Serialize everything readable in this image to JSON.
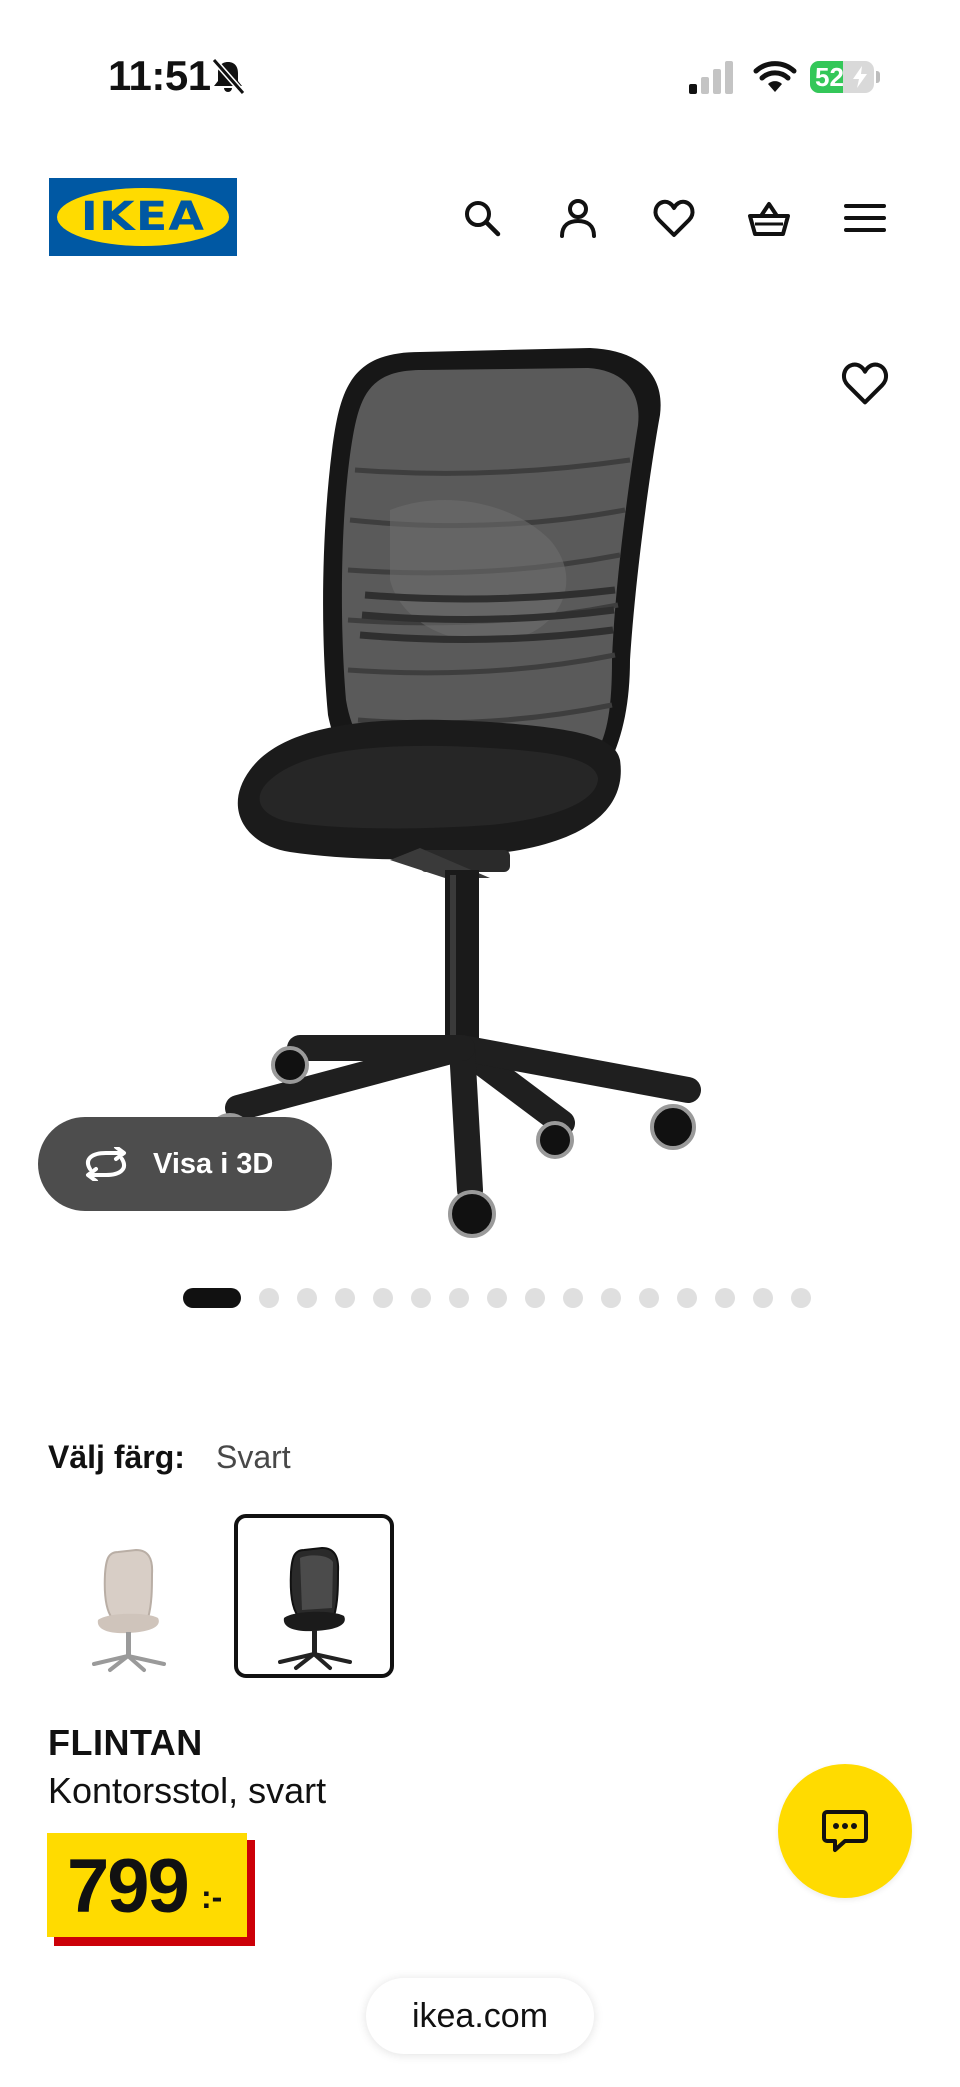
{
  "status_bar": {
    "time": "11:51",
    "battery_percent": "52",
    "battery_level": 0.52,
    "icons": [
      "bell-slash-icon",
      "cellular-signal-icon",
      "wifi-icon",
      "battery-charging-icon"
    ]
  },
  "header": {
    "logo_text": "IKEA",
    "logo_colors": {
      "background": "#0058a3",
      "ellipse": "#ffdb00"
    },
    "icons": [
      "search-icon",
      "user-icon",
      "heart-icon",
      "basket-icon",
      "menu-icon"
    ]
  },
  "gallery": {
    "view_3d_label": "Visa i 3D",
    "favorite_icon": "heart-icon",
    "view_3d_icon": "rotate-arrows-icon",
    "image_count": 16,
    "active_index": 0
  },
  "color_selector": {
    "label": "Välj färg:",
    "selected_value": "Svart",
    "options": [
      {
        "color": "beige",
        "selected": false
      },
      {
        "color": "black",
        "selected": true
      }
    ]
  },
  "product": {
    "name": "FLINTAN",
    "description": "Kontorsstol, svart",
    "price": "799",
    "price_suffix": ":-",
    "price_colors": {
      "background": "#ffdb00",
      "shadow": "#cc0008"
    }
  },
  "chat": {
    "icon": "chat-icon",
    "color": "#ffdb00"
  },
  "browser": {
    "url": "ikea.com"
  }
}
